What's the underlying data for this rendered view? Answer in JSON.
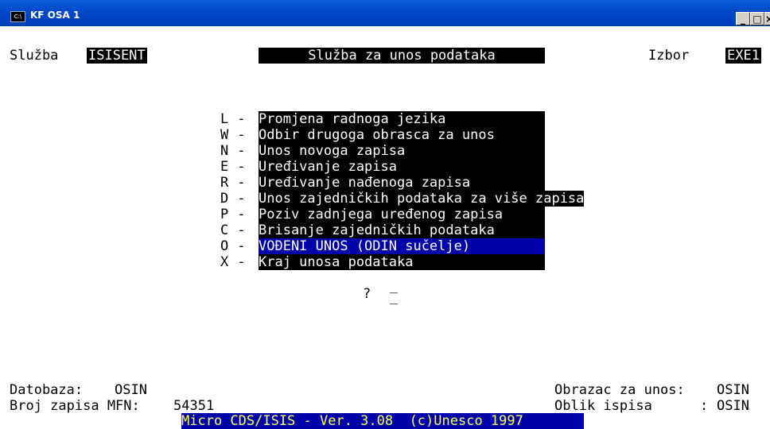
{
  "window": {
    "title": "KF OSA 1",
    "icon": "C:\\",
    "buttons": [
      "_",
      "□",
      "×"
    ]
  },
  "header": {
    "service_label": "Služba",
    "service_value": "ISISENT",
    "center_title": "Služba za unos podataka",
    "choice_label": "Izbor",
    "choice_value": "EXE1"
  },
  "menu": {
    "items": [
      {
        "key": "L",
        "label": "Promjena radnoga jezika"
      },
      {
        "key": "W",
        "label": "Odbir drugoga obrasca za unos"
      },
      {
        "key": "N",
        "label": "Unos novoga zapisa"
      },
      {
        "key": "E",
        "label": "Uređivanje zapisa"
      },
      {
        "key": "R",
        "label": "Uređivanje nađenoga zapisa"
      },
      {
        "key": "D",
        "label": "Unos zajedničkih podataka za više zapisa"
      },
      {
        "key": "P",
        "label": "Poziv zadnjega uređenog zapisa"
      },
      {
        "key": "C",
        "label": "Brisanje zajedničkih podataka"
      },
      {
        "key": "O",
        "label": "VOĐENI UNOS (ODIN sučelje)",
        "selected": true
      },
      {
        "key": "X",
        "label": "Kraj unosa podataka"
      }
    ],
    "separator": "-"
  },
  "prompt": {
    "question": "?",
    "cursor": "_"
  },
  "footer": {
    "database_label": "Datobaza:",
    "database_value": "OSIN",
    "records_label": "Broj zapisa MFN:",
    "records_value": "54351",
    "form_label": "Obrazac za unos:",
    "form_value": "OSIN",
    "print_label": "Oblik ispisa",
    "print_sep": ":",
    "print_value": "OSIN",
    "version": "Micro CDS/ISIS - Ver. 3.08  (c)Unesco 1997"
  }
}
